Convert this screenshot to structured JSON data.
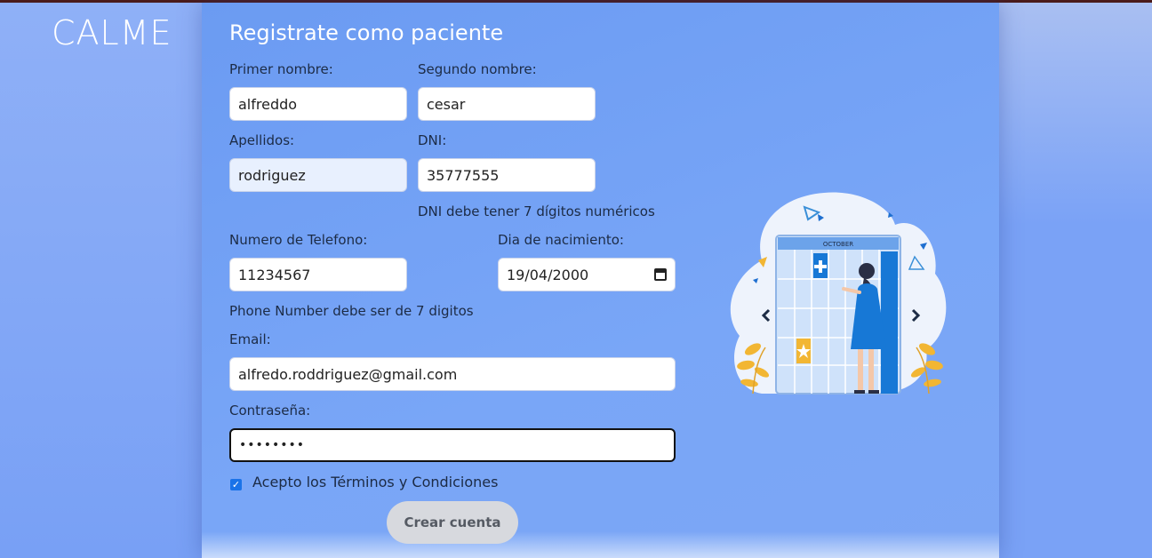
{
  "brand": {
    "logo": "CALME"
  },
  "form": {
    "title": "Registrate como paciente",
    "first_name": {
      "label": "Primer nombre:",
      "value": "alfreddo"
    },
    "second_name": {
      "label": "Segundo nombre:",
      "value": "cesar"
    },
    "last_name": {
      "label": "Apellidos:",
      "value": "rodriguez"
    },
    "dni": {
      "label": "DNI:",
      "value": "35777555",
      "error": "DNI debe tener 7 dígitos numéricos"
    },
    "phone": {
      "label": "Numero de Telefono:",
      "value": "11234567",
      "error": "Phone Number debe ser de 7 digitos"
    },
    "birthdate": {
      "label": "Dia de nacimiento:",
      "value": "19/04/2000"
    },
    "email": {
      "label": "Email:",
      "value": "alfredo.roddriguez@gmail.com"
    },
    "password": {
      "label": "Contraseña:",
      "value": "••••••••"
    },
    "terms": {
      "label": "Acepto los Términos y Condiciones",
      "checked": true
    },
    "submit_label": "Crear cuenta"
  },
  "illustration": {
    "calendar_month": "OCTOBER"
  },
  "colors": {
    "background": "#7aa2f5",
    "accent": "#1a73e8",
    "button": "#d7d9de"
  }
}
